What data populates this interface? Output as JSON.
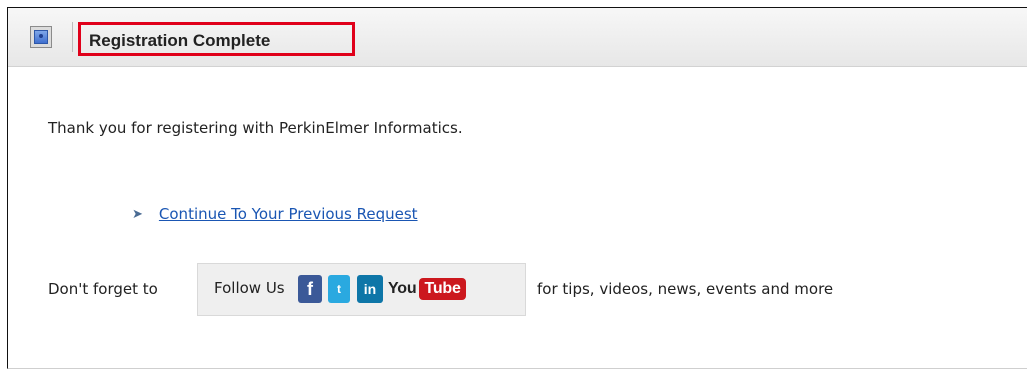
{
  "header": {
    "title": "Registration Complete",
    "title_highlight_color": "#e0001a",
    "icon": "user-profile-icon"
  },
  "main": {
    "thank_you": "Thank you for registering with PerkinElmer Informatics.",
    "continue_link": "Continue To Your Previous Request",
    "continue_icon": "chevron-right-icon",
    "dont_forget": "Don't forget to",
    "follow_label": "Follow Us",
    "social": [
      {
        "name": "facebook",
        "icon": "facebook-icon",
        "text": "f"
      },
      {
        "name": "twitter",
        "icon": "twitter-icon",
        "text": "t"
      },
      {
        "name": "linkedin",
        "icon": "linkedin-icon",
        "text": "in"
      },
      {
        "name": "youtube",
        "icon": "youtube-icon",
        "text_left": "You",
        "text_right": "Tube"
      }
    ],
    "for_tips": "for tips, videos, news, events and more"
  }
}
